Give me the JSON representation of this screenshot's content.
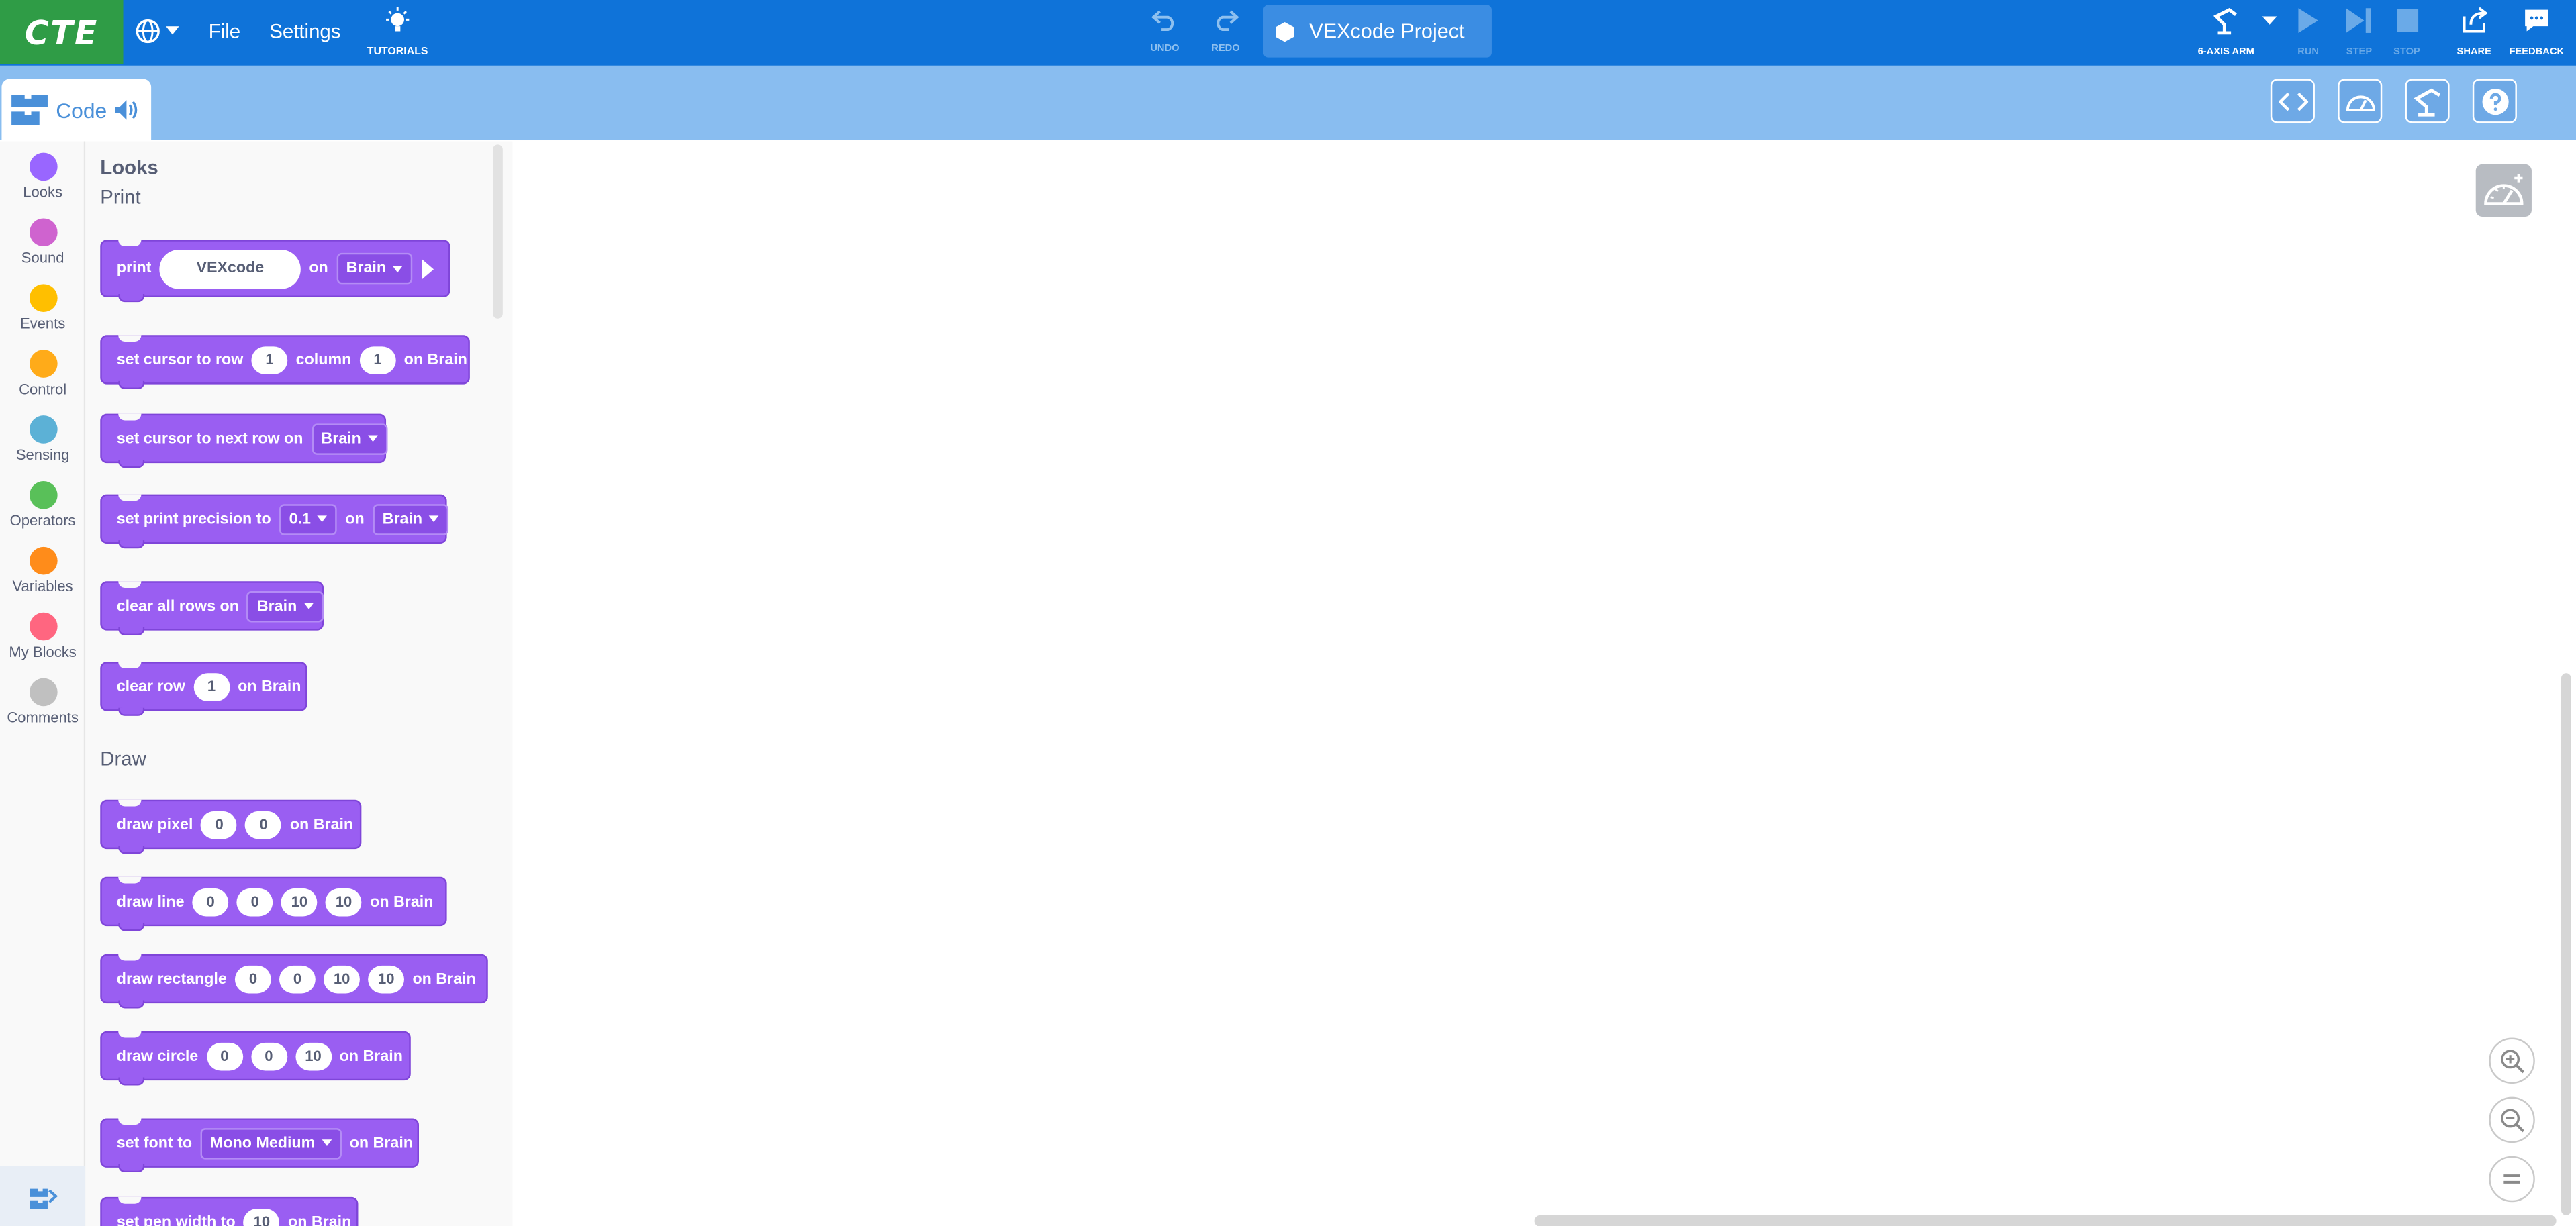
{
  "topbar": {
    "logo_text": "CTE",
    "menu_file": "File",
    "menu_settings": "Settings",
    "tutorials_label": "TUTORIALS",
    "undo_label": "UNDO",
    "redo_label": "REDO",
    "project_name": "VEXcode Project",
    "device_label": "6-AXIS ARM",
    "run_label": "RUN",
    "step_label": "STEP",
    "stop_label": "STOP",
    "share_label": "SHARE",
    "feedback_label": "FEEDBACK",
    "colors": {
      "bar": "#0f73d9",
      "logo_bg": "#2f9c46",
      "subbar": "#89bdf0"
    }
  },
  "code_tab": {
    "label": "Code"
  },
  "categories": [
    {
      "label": "Looks",
      "color": "#9966ff"
    },
    {
      "label": "Sound",
      "color": "#cf63cf"
    },
    {
      "label": "Events",
      "color": "#ffbf00"
    },
    {
      "label": "Control",
      "color": "#ffab19"
    },
    {
      "label": "Sensing",
      "color": "#5cb1d6"
    },
    {
      "label": "Operators",
      "color": "#59c059"
    },
    {
      "label": "Variables",
      "color": "#ff8c1a"
    },
    {
      "label": "My Blocks",
      "color": "#ff6680"
    },
    {
      "label": "Comments",
      "color": "#c0c0c0"
    }
  ],
  "flyout": {
    "title": "Looks",
    "section_print": "Print",
    "section_draw": "Draw",
    "blocks": {
      "print": {
        "label": "print",
        "value": "VEXcode",
        "on": "on",
        "target": "Brain"
      },
      "set_cursor": {
        "label": "set cursor to row",
        "row": "1",
        "col_label": "column",
        "col": "1",
        "suffix": "on Brain"
      },
      "next_row": {
        "label": "set cursor to next row on",
        "target": "Brain"
      },
      "precision": {
        "label": "set print precision to",
        "value": "0.1",
        "on": "on",
        "target": "Brain"
      },
      "clear_all": {
        "label": "clear all rows on",
        "target": "Brain"
      },
      "clear_row": {
        "label": "clear row",
        "value": "1",
        "suffix": "on Brain"
      },
      "draw_pixel": {
        "label": "draw pixel",
        "x": "0",
        "y": "0",
        "suffix": "on Brain"
      },
      "draw_line": {
        "label": "draw line",
        "x1": "0",
        "y1": "0",
        "x2": "10",
        "y2": "10",
        "suffix": "on Brain"
      },
      "draw_rect": {
        "label": "draw rectangle",
        "x": "0",
        "y": "0",
        "w": "10",
        "h": "10",
        "suffix": "on Brain"
      },
      "draw_circle": {
        "label": "draw circle",
        "x": "0",
        "y": "0",
        "r": "10",
        "suffix": "on Brain"
      },
      "set_font": {
        "label": "set font to",
        "value": "Mono Medium",
        "suffix": "on Brain"
      },
      "pen_width": {
        "label": "set pen width to",
        "value": "10",
        "suffix": "on Brain"
      }
    }
  }
}
